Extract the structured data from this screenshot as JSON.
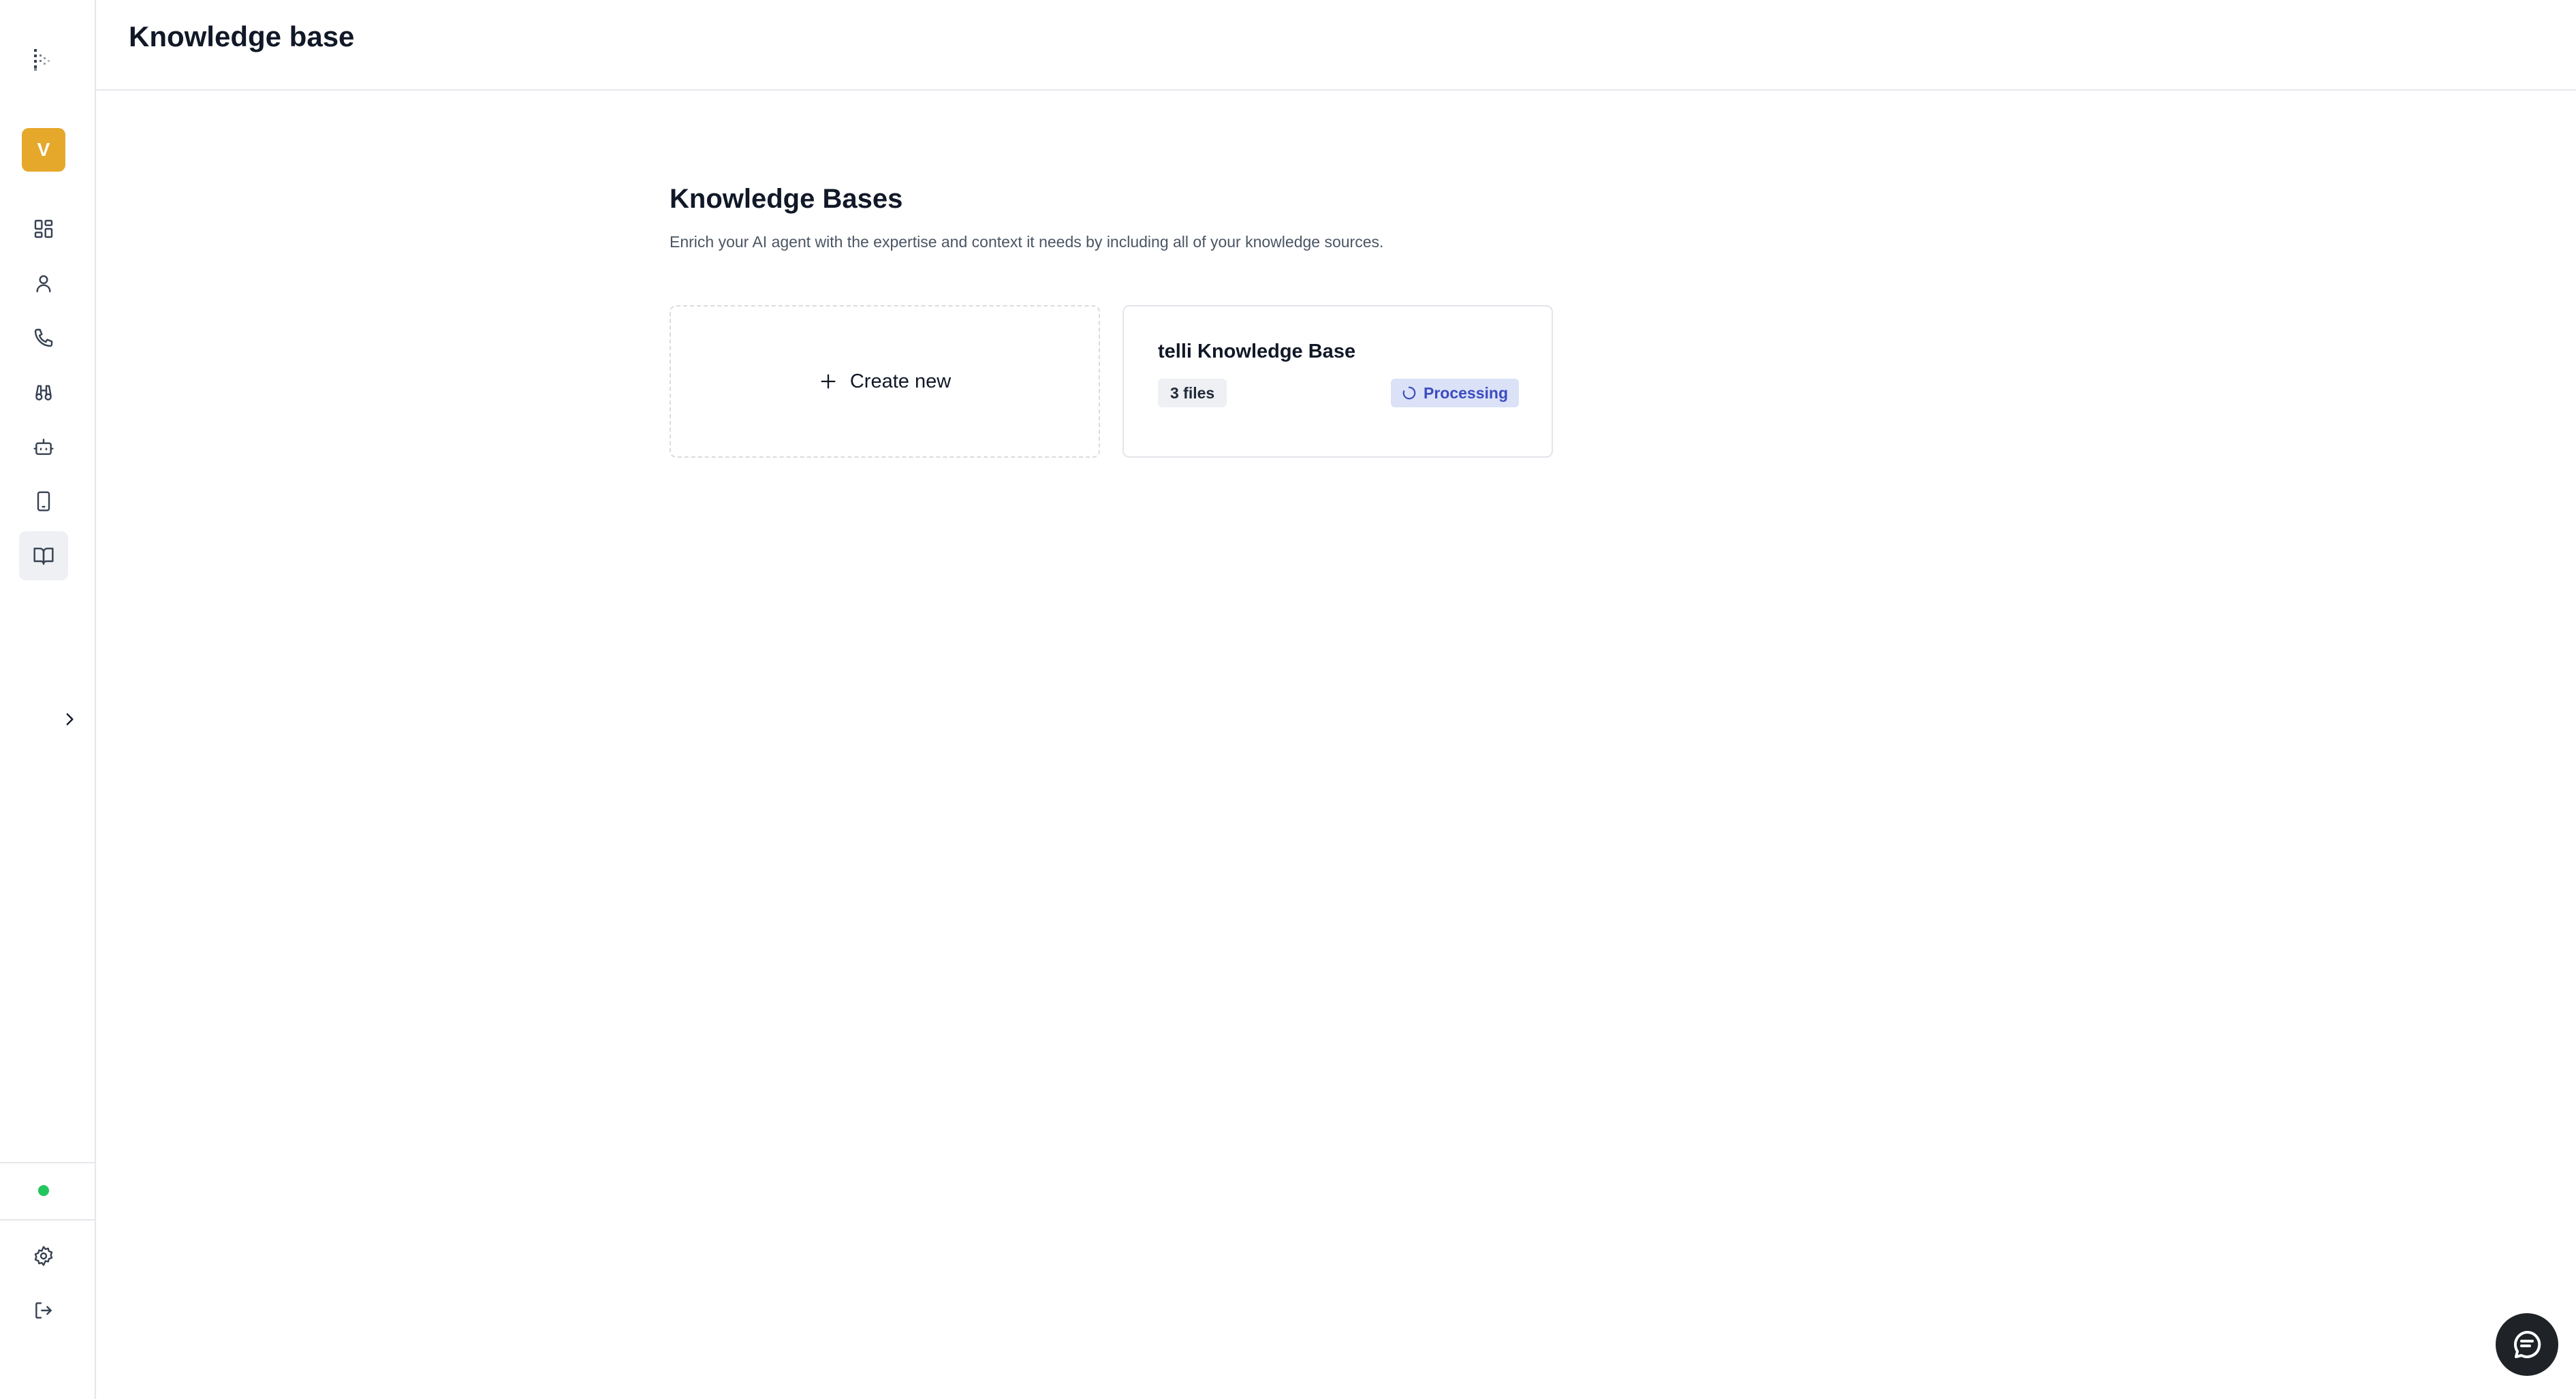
{
  "header": {
    "title": "Knowledge base"
  },
  "sidebar": {
    "avatar_initial": "V",
    "items": [
      {
        "name": "dashboard",
        "icon": "grid-icon",
        "active": false
      },
      {
        "name": "contacts",
        "icon": "user-icon",
        "active": false
      },
      {
        "name": "calls",
        "icon": "phone-icon",
        "active": false
      },
      {
        "name": "campaigns",
        "icon": "binoculars-icon",
        "active": false
      },
      {
        "name": "agents",
        "icon": "bot-icon",
        "active": false
      },
      {
        "name": "phone-numbers",
        "icon": "smartphone-icon",
        "active": false
      },
      {
        "name": "knowledge-base",
        "icon": "book-open-icon",
        "active": true
      }
    ],
    "bottom": [
      {
        "name": "settings",
        "icon": "gear-icon"
      },
      {
        "name": "logout",
        "icon": "logout-icon"
      }
    ],
    "status_color": "#22c55e",
    "avatar_color": "#e6a82b"
  },
  "main": {
    "title": "Knowledge Bases",
    "subtitle": "Enrich your AI agent with the expertise and context it needs by including all of your knowledge sources.",
    "create_label": "Create new",
    "knowledge_bases": [
      {
        "name": "telli Knowledge Base",
        "files": "3 files",
        "status": "Processing",
        "status_color": "#3b4cc0"
      }
    ]
  },
  "chat": {
    "icon": "chat-icon"
  }
}
